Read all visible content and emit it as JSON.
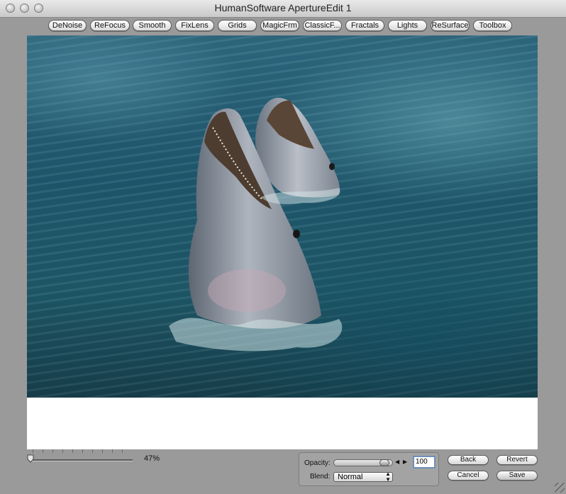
{
  "window": {
    "title": "HumanSoftware ApertureEdit 1"
  },
  "toolbar": {
    "buttons": [
      "DeNoise",
      "ReFocus",
      "Smooth",
      "FixLens",
      "Grids",
      "MagicFrm",
      "ClassicF...",
      "Fractals",
      "Lights",
      "ReSurface",
      "Toolbox"
    ]
  },
  "image": {
    "subject": "dolphins-photo"
  },
  "zoom": {
    "value_label": "47%",
    "level": 0.0
  },
  "opacity": {
    "label": "Opacity:",
    "value": "100",
    "level": 1.0
  },
  "blend": {
    "label": "Blend:",
    "selected": "Normal"
  },
  "actions": {
    "back": "Back",
    "revert": "Revert",
    "cancel": "Cancel",
    "save": "Save"
  },
  "colors": {
    "window_bg": "#9a9a9a",
    "canvas_bg": "#ffffff",
    "water": "#1f5a6a"
  }
}
